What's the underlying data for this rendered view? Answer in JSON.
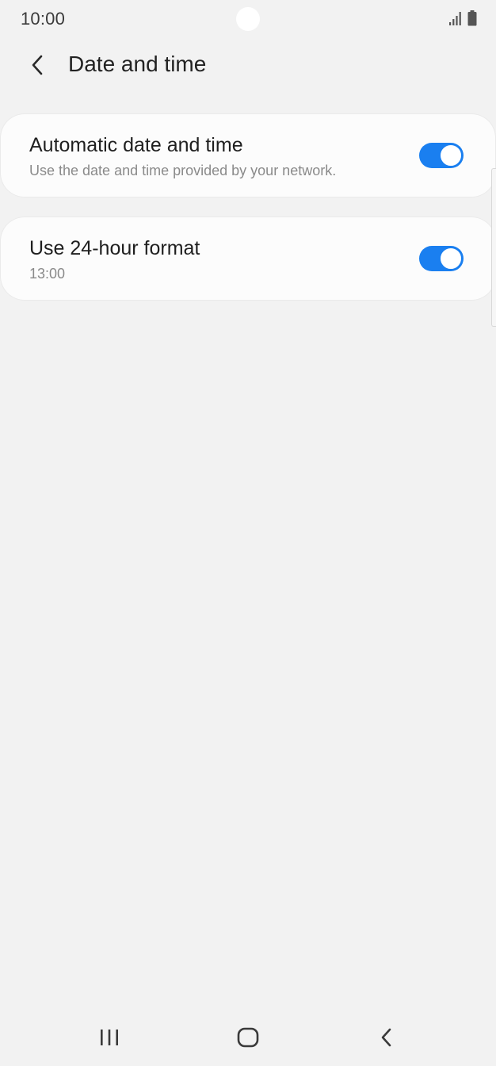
{
  "status_bar": {
    "time": "10:00",
    "icons": [
      "signal-icon",
      "battery-icon"
    ]
  },
  "header": {
    "back_icon": "chevron-left-icon",
    "title": "Date and time"
  },
  "settings": [
    {
      "title": "Automatic date and time",
      "subtitle": "Use the date and time provided by your network.",
      "toggle_on": true
    },
    {
      "title": "Use 24-hour format",
      "subtitle": "13:00",
      "toggle_on": true
    }
  ],
  "nav_bar": {
    "recents_icon": "recents-icon",
    "home_icon": "home-icon",
    "back_icon": "back-icon"
  },
  "colors": {
    "background": "#f2f2f2",
    "card": "#fcfcfc",
    "accent": "#1a7ff0",
    "subtitle": "#8a8a8a"
  }
}
